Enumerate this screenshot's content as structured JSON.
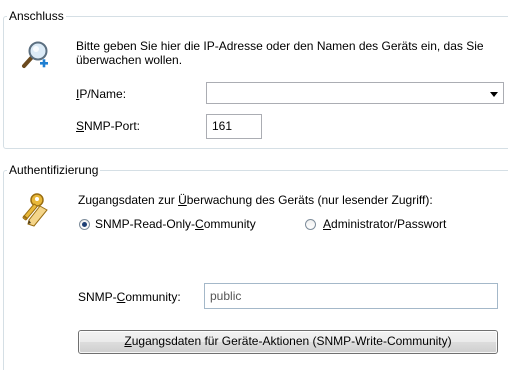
{
  "connection": {
    "legend": "Anschluss",
    "description": "Bitte geben Sie hier die IP-Adresse oder den Namen des Geräts ein, das Sie überwachen wollen.",
    "ip_label_prefix": "I",
    "ip_label_rest": "P/Name:",
    "ip_value": "",
    "snmp_port_label_prefix": "S",
    "snmp_port_label_rest": "NMP-Port:",
    "snmp_port_value": "161",
    "icon": "magnifier-add-icon"
  },
  "authentication": {
    "legend": "Authentifizierung",
    "description_part1": "Zugangsdaten zur ",
    "description_accel": "Ü",
    "description_part2": "berwachung des Geräts (nur lesender Zugriff):",
    "radio_readonly_pre": "SNMP-Read-Only-",
    "radio_readonly_accel": "C",
    "radio_readonly_post": "ommunity",
    "radio_admin_accel": "A",
    "radio_admin_post": "dministrator/Passwort",
    "selected_option": "SNMP-Read-Only-Community",
    "community_label_pre": "SNMP-",
    "community_label_accel": "C",
    "community_label_post": "ommunity:",
    "community_value": "public",
    "button_accel": "Z",
    "button_rest": "ugangsdaten für Geräte-Aktionen (SNMP-Write-Community)",
    "icon": "keys-pencil-icon"
  }
}
